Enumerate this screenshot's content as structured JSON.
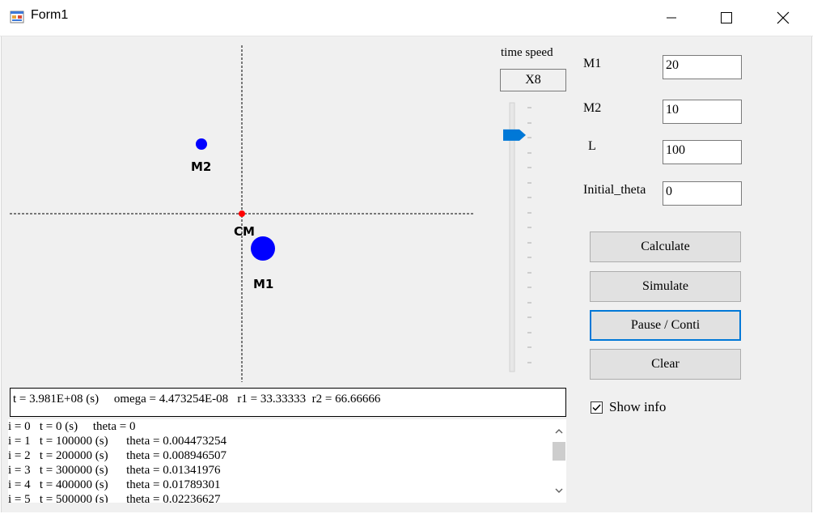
{
  "window": {
    "title": "Form1",
    "minimize_icon": "minimize-icon",
    "maximize_icon": "maximize-icon",
    "close_icon": "close-icon"
  },
  "simulation": {
    "mass1_label": "M1",
    "mass2_label": "M2",
    "cm_label": "CM",
    "mass_color": "#0000ff",
    "cm_color": "#ff0000"
  },
  "time_speed": {
    "label": "time speed",
    "value": "X8",
    "slider_level_fraction": 0.12,
    "accent": "#0078d7"
  },
  "inputs": {
    "m1_label": "M1",
    "m1_value": "20",
    "m2_label": "M2",
    "m2_value": "10",
    "l_label": "L",
    "l_value": "100",
    "theta_label": "Initial_theta",
    "theta_value": "0"
  },
  "buttons": {
    "calculate": "Calculate",
    "simulate": "Simulate",
    "pause": "Pause / Conti",
    "clear": "Clear"
  },
  "show_info": {
    "label": "Show info",
    "checked": true
  },
  "info": "t = 3.981E+08 (s)     omega = 4.473254E-08   r1 = 33.33333  r2 = 66.66666",
  "log": [
    "i = 0   t = 0 (s)     theta = 0",
    "i = 1   t = 100000 (s)      theta = 0.004473254",
    "i = 2   t = 200000 (s)      theta = 0.008946507",
    "i = 3   t = 300000 (s)      theta = 0.01341976",
    "i = 4   t = 400000 (s)      theta = 0.01789301",
    "i = 5   t = 500000 (s)      theta = 0.02236627"
  ]
}
